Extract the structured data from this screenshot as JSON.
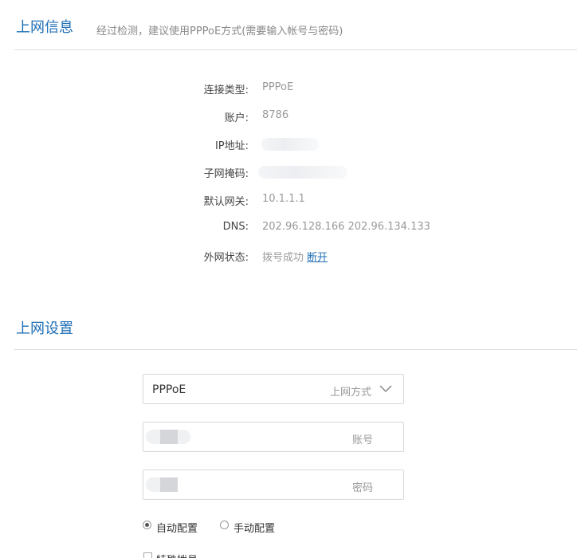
{
  "wan_info": {
    "title": "上网信息",
    "subtitle": "经过检测，建议使用PPPoE方式(需要输入帐号与密码)",
    "rows": [
      {
        "label": "连接类型:",
        "value": "PPPoE"
      },
      {
        "label": "账户:",
        "value": "8786"
      },
      {
        "label": "IP地址:",
        "value": ""
      },
      {
        "label": "子网掩码:",
        "value": ""
      },
      {
        "label": "默认网关:",
        "value": "10.1.1.1"
      },
      {
        "label": "DNS:",
        "value": "202.96.128.166 202.96.134.133"
      },
      {
        "label": "外网状态:",
        "value": "拨号成功",
        "link": "断开"
      }
    ]
  },
  "wan_settings": {
    "title": "上网设置",
    "mode_select": {
      "value": "PPPoE",
      "hint": "上网方式"
    },
    "account_field": {
      "hint": "账号"
    },
    "password_field": {
      "hint": "密码"
    },
    "radio_auto": {
      "label": "自动配置",
      "checked": true
    },
    "radio_manual": {
      "label": "手动配置",
      "checked": false
    },
    "checkbox": {
      "label": "特殊拨号"
    }
  },
  "colors": {
    "accent": "#1f6fb5",
    "label": "#444444",
    "value": "#999999"
  }
}
